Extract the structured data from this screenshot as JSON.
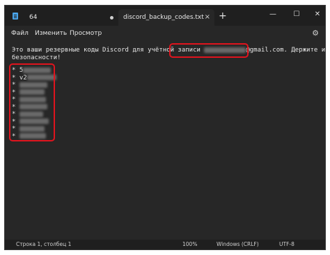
{
  "tabs": {
    "inactive_label": "64",
    "active_label": "discord_backup_codes.txt",
    "add_symbol": "+",
    "close_symbol": "×"
  },
  "window_controls": {
    "minimize": "—",
    "maximize": "☐",
    "close": "✕"
  },
  "menu": {
    "file": "Файл",
    "edit": "Изменить",
    "view": "Просмотр",
    "settings_icon": "⚙"
  },
  "editor": {
    "line1_before": "Это ваши резервные коды Discord для учётной записи ",
    "line1_email_domain": "@gmail.com",
    "line1_after": ". Держите их в",
    "line2": "безопасности!",
    "codes": [
      {
        "bullet": "*",
        "visible": "5"
      },
      {
        "bullet": "*",
        "visible": "v2"
      },
      {
        "bullet": "*",
        "visible": ""
      },
      {
        "bullet": "*",
        "visible": ""
      },
      {
        "bullet": "*",
        "visible": ""
      },
      {
        "bullet": "*",
        "visible": ""
      },
      {
        "bullet": "*",
        "visible": ""
      },
      {
        "bullet": "*",
        "visible": ""
      },
      {
        "bullet": "*",
        "visible": ""
      },
      {
        "bullet": "*",
        "visible": ""
      }
    ]
  },
  "status": {
    "position": "Строка 1, столбец 1",
    "zoom": "100%",
    "line_endings": "Windows (CRLF)",
    "encoding": "UTF-8"
  },
  "colors": {
    "highlight": "#e0141e",
    "background": "#272727",
    "titlebar": "#1f1f1f"
  }
}
